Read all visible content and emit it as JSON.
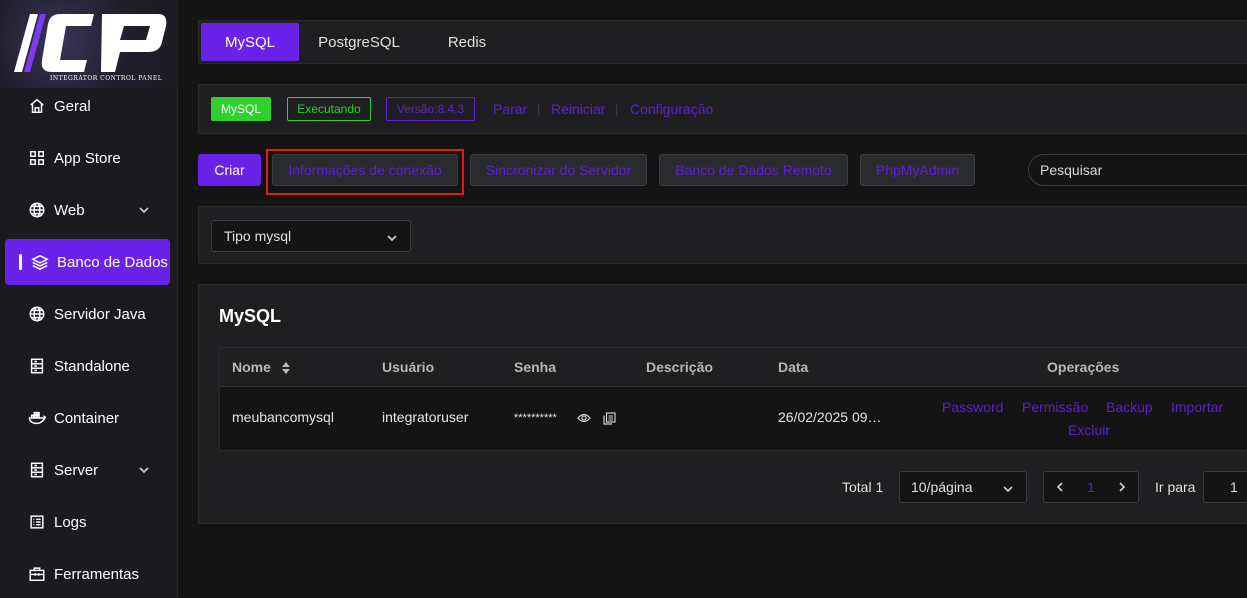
{
  "logo": {
    "tagline": "INTEGRATOR CONTROL PANEL"
  },
  "sidebar": {
    "items": [
      {
        "label": "Geral",
        "icon": "home-icon"
      },
      {
        "label": "App Store",
        "icon": "grid-icon"
      },
      {
        "label": "Web",
        "icon": "globe-icon",
        "expandable": true
      },
      {
        "label": "Banco de Dados",
        "icon": "layers-icon",
        "active": true
      },
      {
        "label": "Servidor Java",
        "icon": "globe-icon"
      },
      {
        "label": "Standalone",
        "icon": "server-icon"
      },
      {
        "label": "Container",
        "icon": "docker-icon"
      },
      {
        "label": "Server",
        "icon": "server-icon",
        "expandable": true
      },
      {
        "label": "Logs",
        "icon": "list-icon"
      },
      {
        "label": "Ferramentas",
        "icon": "toolbox-icon"
      }
    ]
  },
  "tabs": [
    {
      "label": "MySQL",
      "active": true
    },
    {
      "label": "PostgreSQL"
    },
    {
      "label": "Redis"
    }
  ],
  "status": {
    "app_badge": "MySQL",
    "state_badge": "Executando",
    "version_badge": "Versão:8.4.3",
    "links": [
      "Parar",
      "Reiniciar",
      "Configuração"
    ]
  },
  "toolbar": {
    "create": "Criar",
    "connection_info": "Informações de conexão",
    "sync": "Sincronizar do Servidor",
    "remote_db": "Banco de Dados Remoto",
    "phpmyadmin": "PhpMyAdmin",
    "search_placeholder": "Pesquisar"
  },
  "filter": {
    "label": "Tipo",
    "value": "mysql"
  },
  "card": {
    "title": "MySQL",
    "columns": [
      "Nome",
      "Usuário",
      "Senha",
      "Descrição",
      "Data",
      "Operações"
    ],
    "rows": [
      {
        "name": "meubancomysql",
        "user": "integratoruser",
        "password": "**********",
        "description": "",
        "date": "26/02/2025 09…"
      }
    ],
    "operations": [
      "Password",
      "Permissão",
      "Backup",
      "Importar",
      "Excluir"
    ]
  },
  "pagination": {
    "total": "Total 1",
    "page_size": "10/página",
    "current_page": "1",
    "goto_label": "Ir para",
    "goto_value": "1"
  },
  "colors": {
    "accent": "#6a22e8",
    "link": "#5c1fd6",
    "running": "#2fd12f",
    "highlight": "#e01b1b"
  }
}
